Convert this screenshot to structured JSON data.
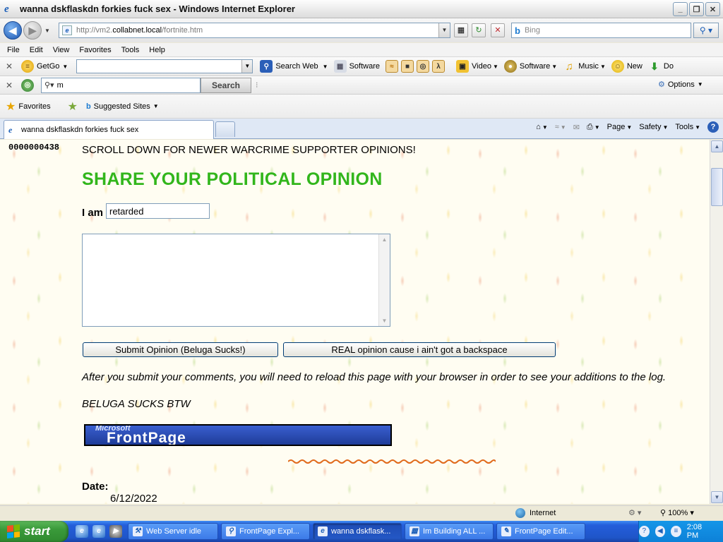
{
  "window": {
    "title": "wanna dskflaskdn forkies fuck sex - Windows Internet Explorer",
    "buttons": {
      "minimize": "_",
      "maximize": "❐",
      "close": "✕"
    }
  },
  "address": {
    "url_prefix": "http://vm2.",
    "url_host": "collabnet.local",
    "url_path": "/fortnite.htm",
    "bing_placeholder": "Bing"
  },
  "menu": [
    "File",
    "Edit",
    "View",
    "Favorites",
    "Tools",
    "Help"
  ],
  "toolbar1": {
    "getgo_label": "GetGo",
    "search_web_label": "Search Web",
    "software_label": "Software",
    "video_label": "Video",
    "software2_label": "Software",
    "music_label": "Music",
    "new_label": "New",
    "do_label": "Do"
  },
  "toolbar2": {
    "search_value": "m",
    "search_button": "Search",
    "options_label": "Options"
  },
  "favorites_bar": {
    "favorites_label": "Favorites",
    "suggested_sites_label": "Suggested Sites"
  },
  "tab": {
    "title": "wanna dskflaskdn forkies fuck sex"
  },
  "command_bar": {
    "page": "Page",
    "safety": "Safety",
    "tools": "Tools"
  },
  "page": {
    "hit_counter": "0000000438",
    "scroll_notice": "SCROLL DOWN FOR NEWER WARCRIME SUPPORTER OPINIONS!",
    "heading": "SHARE YOUR POLITICAL OPINION",
    "i_am_label": "I am",
    "i_am_value": "retarded",
    "opinion_text": "",
    "submit_button": "Submit Opinion (Beluga Sucks!)",
    "real_button": "REAL opinion cause i ain't got a backspace",
    "after_text": "After you submit your comments, you will need to reload this page with your browser in order to see your additions to the log.",
    "beluga_text": "BELUGA SUCKS BTW",
    "logo_ms": "Microsoft",
    "logo_fp": "FrontPage",
    "date_label": "Date:",
    "date_value": "6/12/2022"
  },
  "status": {
    "zone": "Internet",
    "zoom": "100%"
  },
  "taskbar": {
    "start": "start",
    "items": [
      {
        "label": "Web Server idle",
        "active": false
      },
      {
        "label": "FrontPage Expl...",
        "active": false
      },
      {
        "label": "wanna dskflask...",
        "active": true
      },
      {
        "label": "Im Building ALL ...",
        "active": false
      },
      {
        "label": "FrontPage Edit...",
        "active": false
      }
    ],
    "clock": "2:08 PM"
  },
  "colors": {
    "heading_green": "#32b61c",
    "taskbar_blue": "#245edb",
    "start_green": "#3a9a3a"
  }
}
